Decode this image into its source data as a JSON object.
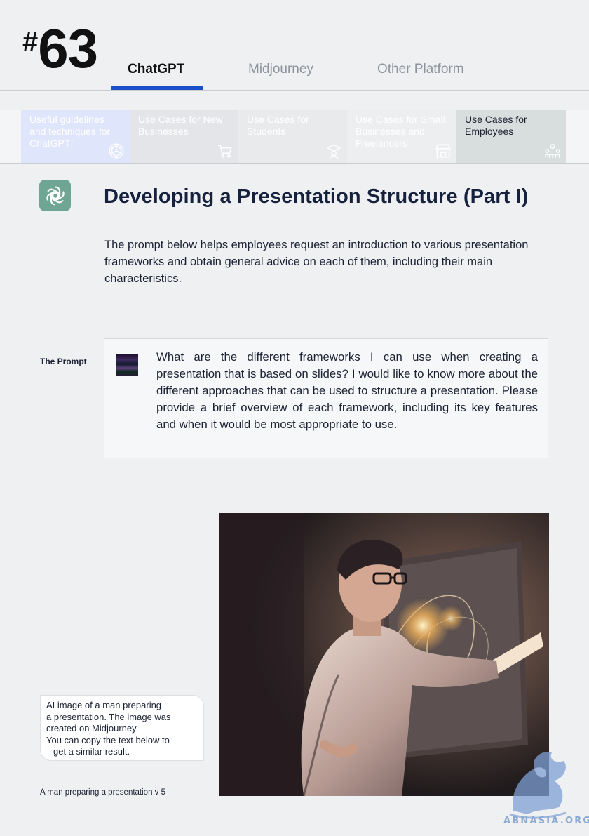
{
  "header": {
    "page_hash": "#",
    "page_number": "63",
    "tabs": [
      {
        "label": "ChatGPT",
        "active": true
      },
      {
        "label": "Midjourney",
        "active": false
      },
      {
        "label": "Other Platform",
        "active": false
      }
    ]
  },
  "categories": [
    {
      "label": "Useful guidelines and techniques for ChatGPT",
      "icon": "openai-logo-icon",
      "color": "#dfe6fb"
    },
    {
      "label": "Use Cases for New Businesses",
      "icon": "cart-icon",
      "color": "#e3e5e8"
    },
    {
      "label": "Use Cases for Students",
      "icon": "graduate-icon",
      "color": "#e8eaec"
    },
    {
      "label": "Use Cases for Small Businesses and Freelancers",
      "icon": "store-icon",
      "color": "#eceeef"
    },
    {
      "label": "Use Cases for Employees",
      "icon": "team-icon",
      "color": "#d7dedd",
      "active": true
    }
  ],
  "main": {
    "title": "Developing a Presentation Structure (Part I)",
    "intro": "The prompt below helps employees request an introduction to various presentation frameworks and obtain general advice on each of them, including their main characteristics."
  },
  "prompt": {
    "label": "The Prompt",
    "text": "What are the different frameworks I can use when creating a presentation that is based on slides? I would like to know more about the different approaches that can be used to structure a presentation. Please provide a brief overview of each framework, including its key features and when it would be most appropriate to use."
  },
  "image": {
    "caption_lines": [
      "AI image of a man preparing",
      "a presentation. The image was",
      "created on Midjourney.",
      "You can copy the text below to",
      "get a similar result."
    ],
    "midjourney_prompt": "A man preparing a presentation v 5"
  },
  "watermark": {
    "text": "ABNASIA.ORG"
  },
  "colors": {
    "accent": "#1a4fc9",
    "logo_bg": "#6fa593",
    "title": "#16213e"
  }
}
